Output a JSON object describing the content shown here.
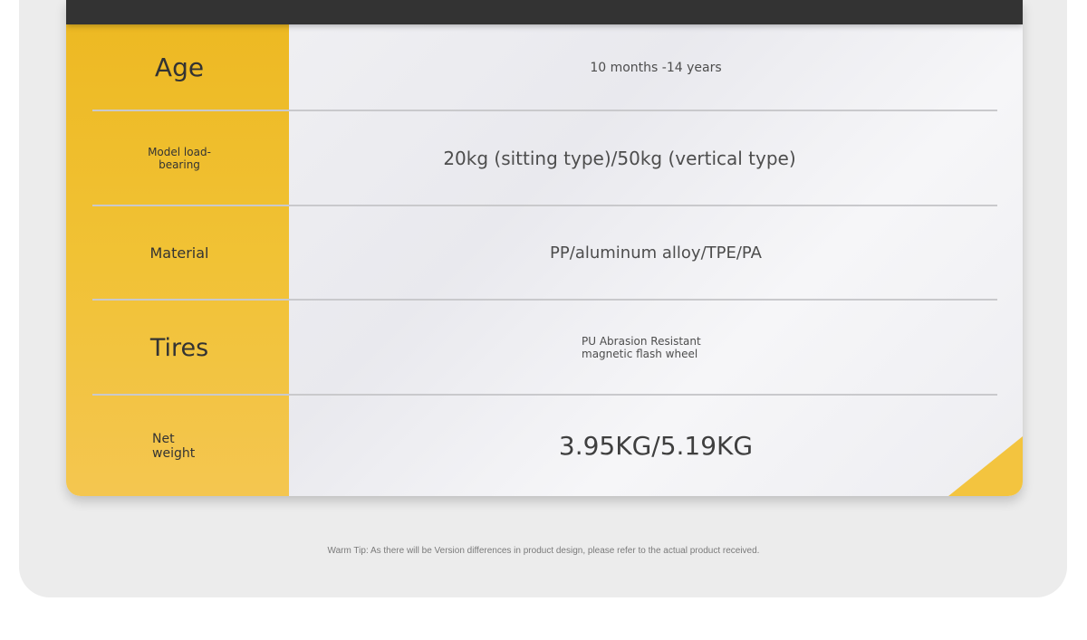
{
  "specs": [
    {
      "label": "Age",
      "value": "10 months -14 years"
    },
    {
      "label": "Model load-bearing",
      "label_line1": "Model load-",
      "label_line2": "bearing",
      "value": "20kg (sitting type)/50kg (vertical type)"
    },
    {
      "label": "Material",
      "value": "PP/aluminum alloy/TPE/PA"
    },
    {
      "label": "Tires",
      "value": "PU Abrasion Resistant magnetic flash wheel",
      "value_line1": "PU Abrasion Resistant",
      "value_line2": "magnetic flash wheel"
    },
    {
      "label": "Net weight",
      "label_line1": "Net",
      "label_line2": "weight",
      "value": "3.95KG/5.19KG"
    }
  ],
  "footer": {
    "warm_tip": "Warm Tip: As there will be Version differences in product design, please refer to the actual product received."
  },
  "colors": {
    "accent_yellow": "#f1c235",
    "header_bar": "#333333",
    "panel_bg": "#ececec"
  }
}
